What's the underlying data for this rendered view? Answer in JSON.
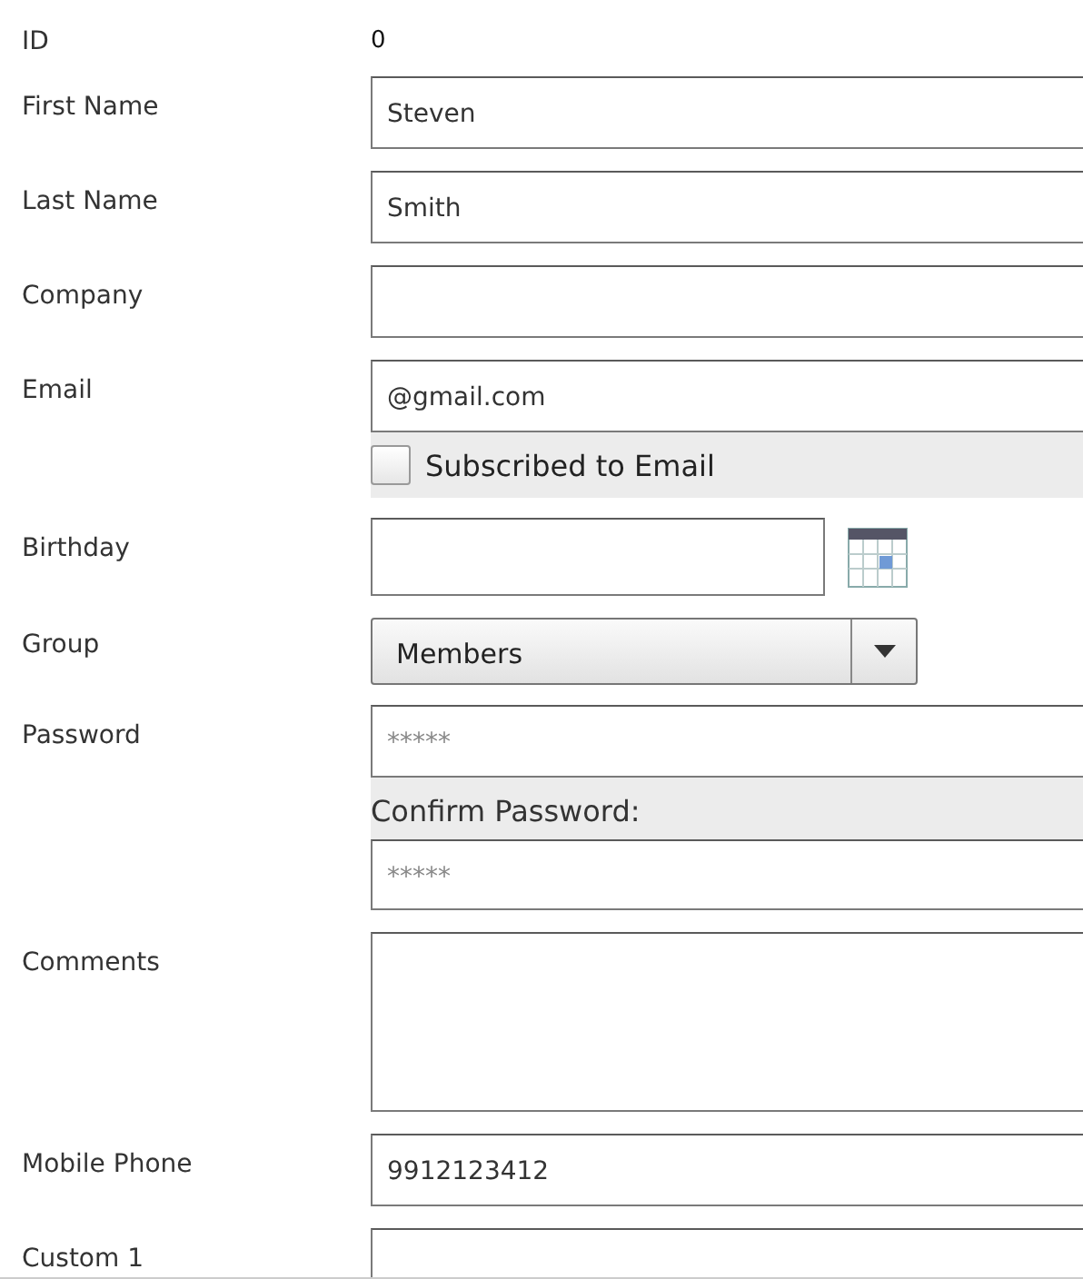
{
  "fields": [
    {
      "kind": "static",
      "label": "ID",
      "value": "0"
    },
    {
      "kind": "text",
      "label": "First Name",
      "value": "Steven"
    },
    {
      "kind": "text",
      "label": "Last Name",
      "value": "Smith"
    },
    {
      "kind": "text",
      "label": "Company"
    },
    {
      "kind": "email",
      "label": "Email",
      "value": "@gmail.com",
      "subscribe": {
        "label": "Subscribed to Email",
        "checked": false
      }
    },
    {
      "kind": "date",
      "label": "Birthday"
    },
    {
      "kind": "select",
      "label": "Group",
      "value": "Members"
    },
    {
      "kind": "password",
      "label": "Password",
      "value": "*****",
      "confirm": {
        "label": "Confirm Password:",
        "value": "*****"
      }
    },
    {
      "kind": "textarea",
      "label": "Comments"
    },
    {
      "kind": "text",
      "label": "Mobile Phone",
      "value": "9912123412"
    },
    {
      "kind": "partial",
      "label": "Custom 1"
    }
  ]
}
